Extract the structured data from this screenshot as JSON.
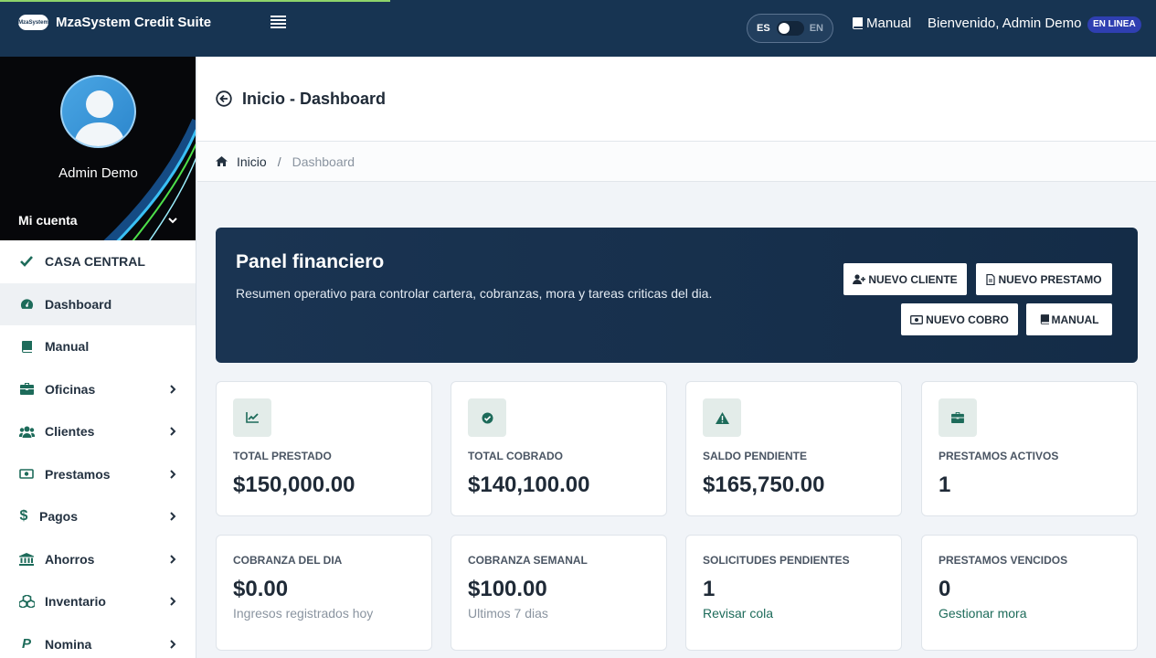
{
  "topbar": {
    "brand_name": "MzaSystem Credit Suite",
    "logo_text": "MzaSystem",
    "lang_es": "ES",
    "lang_en": "EN",
    "manual_label": "Manual",
    "welcome": "Bienvenido, Admin Demo",
    "status": "EN LINEA"
  },
  "sidebar": {
    "user_name": "Admin Demo",
    "account_label": "Mi cuenta",
    "items": [
      {
        "label": "CASA CENTRAL",
        "icon": "check-icon"
      },
      {
        "label": "Dashboard",
        "icon": "dashboard-icon"
      },
      {
        "label": "Manual",
        "icon": "book-icon"
      },
      {
        "label": "Oficinas",
        "icon": "briefcase-icon"
      },
      {
        "label": "Clientes",
        "icon": "users-icon"
      },
      {
        "label": "Prestamos",
        "icon": "money-icon"
      },
      {
        "label": "Pagos",
        "icon": "dollar-icon"
      },
      {
        "label": "Ahorros",
        "icon": "bank-icon"
      },
      {
        "label": "Inventario",
        "icon": "cubes-icon"
      },
      {
        "label": "Nomina",
        "icon": "paypal-icon"
      }
    ]
  },
  "page": {
    "title": "Inicio - Dashboard",
    "breadcrumb_home": "Inicio",
    "breadcrumb_sep": "/",
    "breadcrumb_current": "Dashboard"
  },
  "hero": {
    "title": "Panel financiero",
    "subtitle": "Resumen operativo para controlar cartera, cobranzas, mora y tareas criticas del dia.",
    "buttons": {
      "new_client": "NUEVO CLIENTE",
      "new_loan": "NUEVO PRESTAMO",
      "new_payment": "NUEVO COBRO",
      "manual": "MANUAL"
    }
  },
  "stats": [
    {
      "label": "TOTAL PRESTADO",
      "value": "$150,000.00",
      "icon": "chart-line-icon"
    },
    {
      "label": "TOTAL COBRADO",
      "value": "$140,100.00",
      "icon": "check-circle-icon"
    },
    {
      "label": "SALDO PENDIENTE",
      "value": "$165,750.00",
      "icon": "warning-icon"
    },
    {
      "label": "PRESTAMOS ACTIVOS",
      "value": "1",
      "icon": "briefcase-icon"
    }
  ],
  "metrics": [
    {
      "label": "COBRANZA DEL DIA",
      "value": "$0.00",
      "note": "Ingresos registrados hoy"
    },
    {
      "label": "COBRANZA SEMANAL",
      "value": "$100.00",
      "note": "Ultimos 7 dias"
    },
    {
      "label": "SOLICITUDES PENDIENTES",
      "value": "1",
      "note": "Revisar cola"
    },
    {
      "label": "PRESTAMOS VENCIDOS",
      "value": "0",
      "note": "Gestionar mora"
    }
  ],
  "colors": {
    "topbar": "#173452",
    "accent": "#1d6b5a",
    "status_badge": "#2f3fb1",
    "progress": "#8ed36a"
  }
}
